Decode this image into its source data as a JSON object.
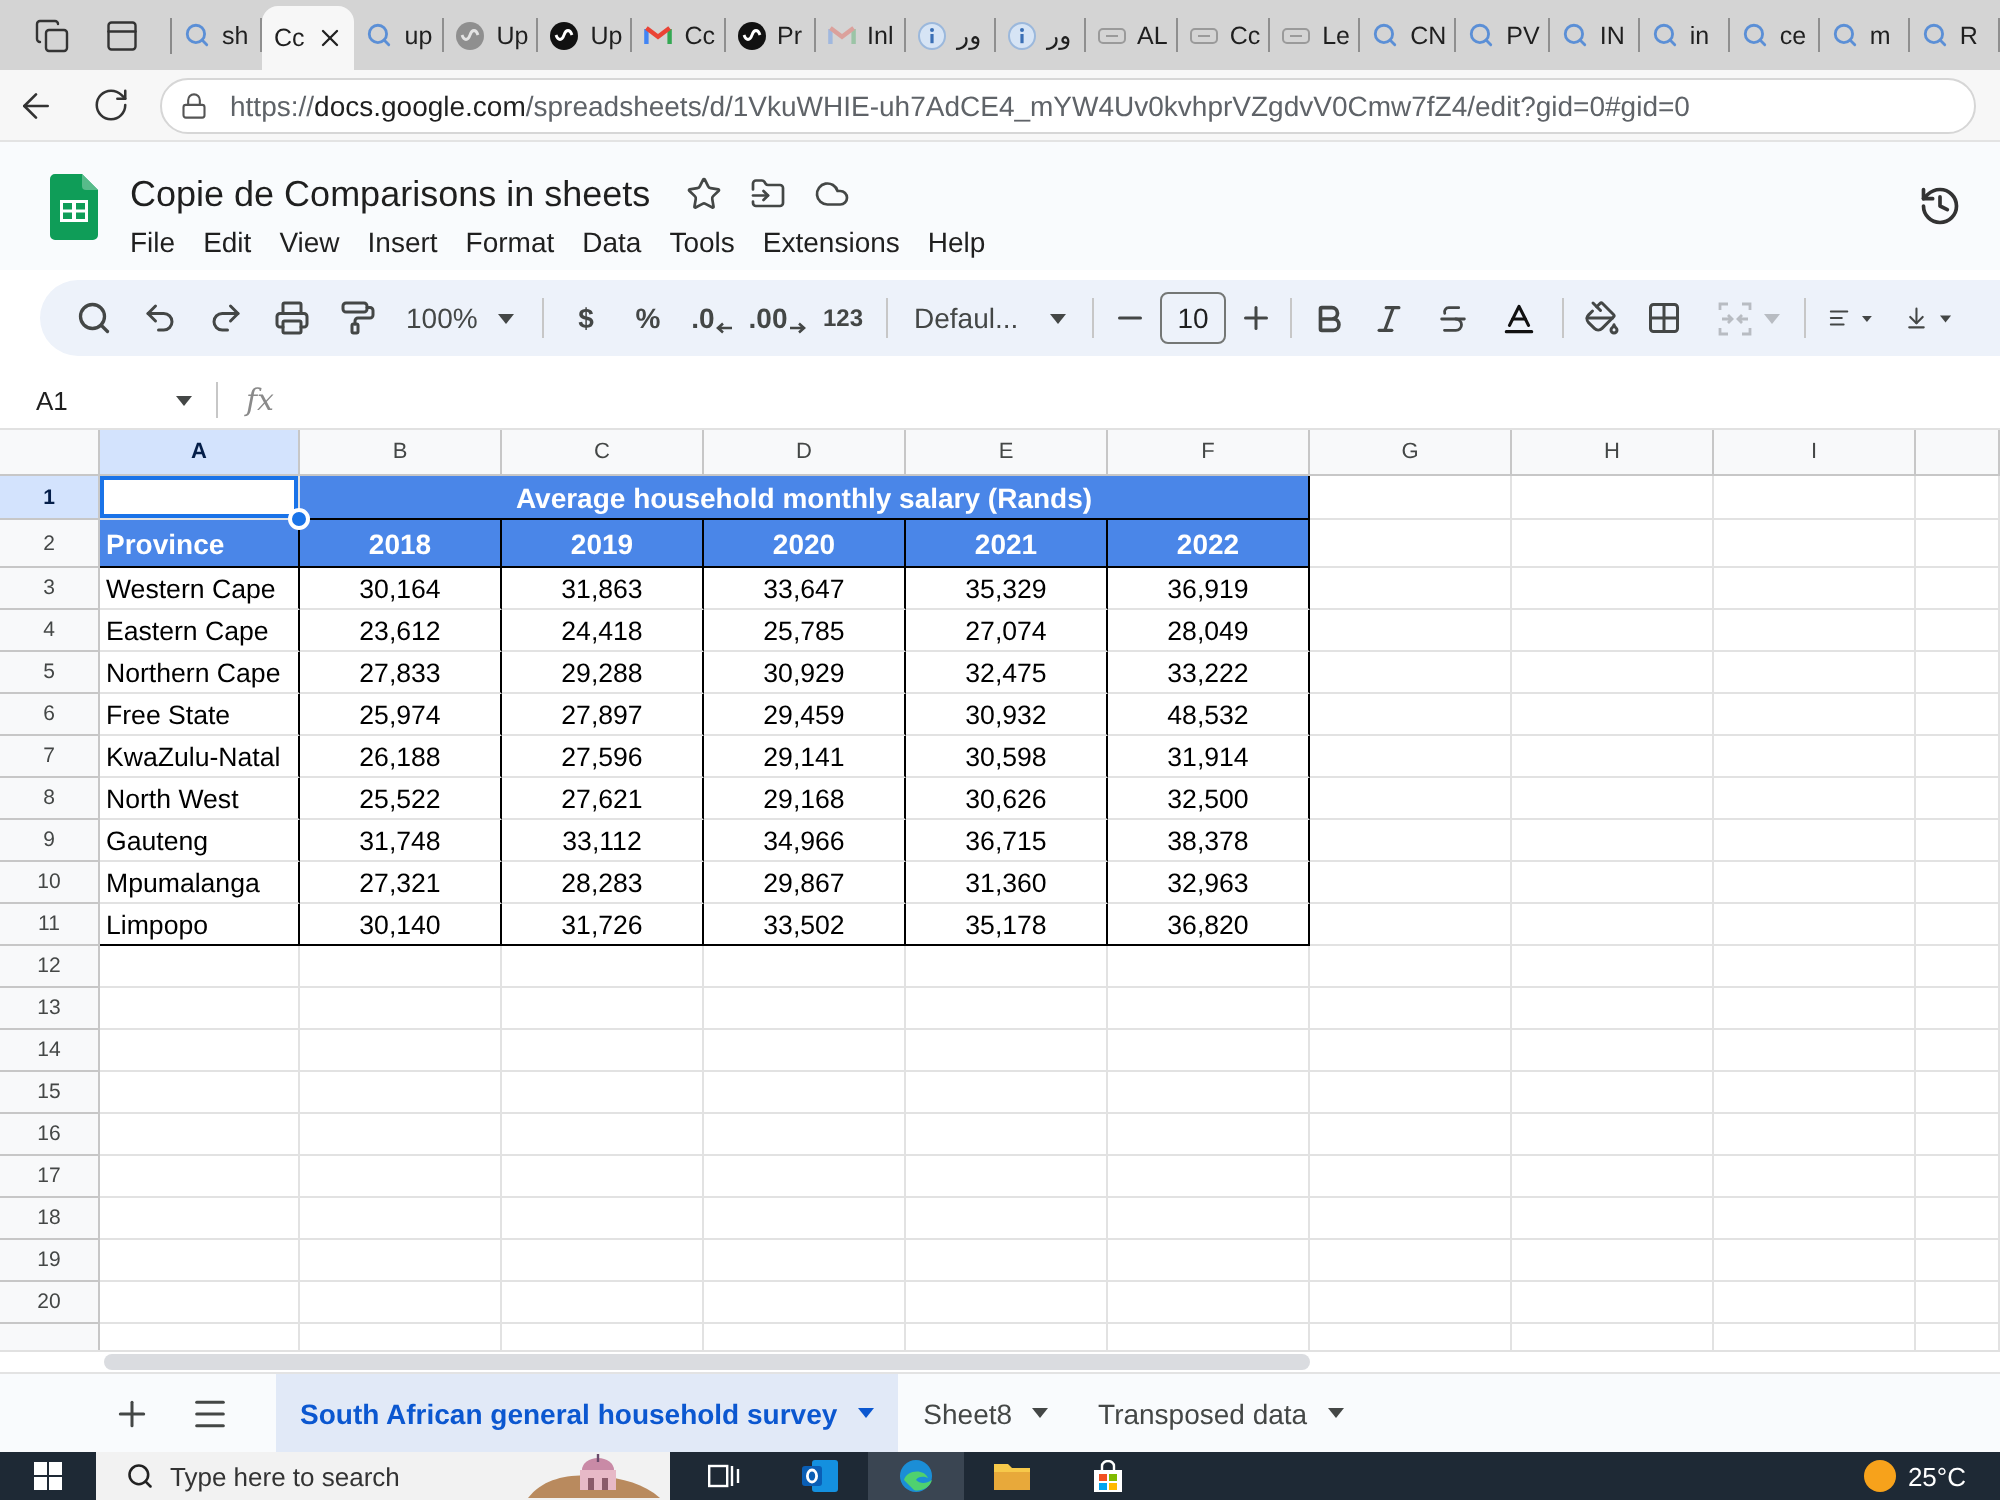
{
  "browser": {
    "tabs": [
      {
        "kind": "search",
        "title": "sh",
        "selected": false,
        "sleeping": false
      },
      {
        "title": "Cc",
        "selected": true
      },
      {
        "kind": "search",
        "title": "up",
        "selected": false,
        "sleeping": false
      },
      {
        "kind": "round-logo",
        "title": "Up",
        "selected": false,
        "sleeping": true
      },
      {
        "kind": "round-logo",
        "title": "Up",
        "selected": false,
        "sleeping": false
      },
      {
        "kind": "mail",
        "title": "Cc",
        "selected": false,
        "sleeping": false
      },
      {
        "kind": "round-logo",
        "title": "Pr",
        "selected": false,
        "sleeping": false
      },
      {
        "kind": "mail",
        "title": "Inl",
        "selected": false,
        "sleeping": true
      },
      {
        "kind": "info",
        "title": "ور",
        "selected": false,
        "sleeping": false
      },
      {
        "kind": "info",
        "title": "ور",
        "selected": false,
        "sleeping": false
      },
      {
        "kind": "tag",
        "title": "AL",
        "selected": false,
        "sleeping": false
      },
      {
        "kind": "tag",
        "title": "Cc",
        "selected": false,
        "sleeping": false
      },
      {
        "kind": "tag",
        "title": "Le",
        "selected": false,
        "sleeping": false
      },
      {
        "kind": "search",
        "title": "CN",
        "selected": false,
        "sleeping": false
      },
      {
        "kind": "search",
        "title": "PV",
        "selected": false,
        "sleeping": false
      },
      {
        "kind": "search",
        "title": "IN",
        "selected": false,
        "sleeping": false
      },
      {
        "kind": "search",
        "title": "in",
        "selected": false,
        "sleeping": false
      },
      {
        "kind": "search",
        "title": "ce",
        "selected": false,
        "sleeping": false
      },
      {
        "kind": "search",
        "title": "m",
        "selected": false,
        "sleeping": false
      },
      {
        "kind": "search",
        "title": "R",
        "selected": false,
        "sleeping": false
      }
    ],
    "address": {
      "scheme": "https://",
      "host": "docs.google.com",
      "path": "/spreadsheets/d/1VkuWHIE-uh7AdCE4_mYW4Uv0kvhprVZgdvV0Cmw7fZ4/edit?gid=0#gid=0"
    }
  },
  "document": {
    "title": "Copie de Comparisons in sheets",
    "menu": [
      "File",
      "Edit",
      "View",
      "Insert",
      "Format",
      "Data",
      "Tools",
      "Extensions",
      "Help"
    ]
  },
  "toolbar": {
    "zoom": "100%",
    "currency": "$",
    "percent": "%",
    "decrease_decimal": ".0",
    "increase_decimal": ".00",
    "number_format": "123",
    "font": "Defaul...",
    "font_size": "10",
    "merge_disabled": true
  },
  "formula_bar": {
    "cell_ref": "A1",
    "function_label": "fx"
  },
  "grid": {
    "columns": [
      {
        "label": "A",
        "selected": true
      },
      {
        "label": "B",
        "selected": false
      },
      {
        "label": "C",
        "selected": false
      },
      {
        "label": "D",
        "selected": false
      },
      {
        "label": "E",
        "selected": false
      },
      {
        "label": "F",
        "selected": false
      },
      {
        "label": "G",
        "selected": false
      },
      {
        "label": "H",
        "selected": false
      },
      {
        "label": "I",
        "selected": false
      }
    ],
    "row_numbers": [
      {
        "label": "1",
        "selected": true
      },
      {
        "label": "2",
        "selected": false
      },
      {
        "label": "3",
        "selected": false
      },
      {
        "label": "4",
        "selected": false
      },
      {
        "label": "5",
        "selected": false
      },
      {
        "label": "6",
        "selected": false
      },
      {
        "label": "7",
        "selected": false
      },
      {
        "label": "8",
        "selected": false
      },
      {
        "label": "9",
        "selected": false
      },
      {
        "label": "10",
        "selected": false
      },
      {
        "label": "11",
        "selected": false
      },
      {
        "label": "12",
        "selected": false
      },
      {
        "label": "13",
        "selected": false
      },
      {
        "label": "14",
        "selected": false
      },
      {
        "label": "15",
        "selected": false
      },
      {
        "label": "16",
        "selected": false
      },
      {
        "label": "17",
        "selected": false
      },
      {
        "label": "18",
        "selected": false
      },
      {
        "label": "19",
        "selected": false
      },
      {
        "label": "20",
        "selected": false
      }
    ],
    "table": {
      "title": "Average household monthly salary (Rands)",
      "header": [
        "Province",
        "2018",
        "2019",
        "2020",
        "2021",
        "2022"
      ],
      "rows": [
        [
          "Western Cape",
          "30,164",
          "31,863",
          "33,647",
          "35,329",
          "36,919"
        ],
        [
          "Eastern Cape",
          "23,612",
          "24,418",
          "25,785",
          "27,074",
          "28,049"
        ],
        [
          "Northern Cape",
          "27,833",
          "29,288",
          "30,929",
          "32,475",
          "33,222"
        ],
        [
          "Free State",
          "25,974",
          "27,897",
          "29,459",
          "30,932",
          "48,532"
        ],
        [
          "KwaZulu-Natal",
          "26,188",
          "27,596",
          "29,141",
          "30,598",
          "31,914"
        ],
        [
          "North West",
          "25,522",
          "27,621",
          "29,168",
          "30,626",
          "32,500"
        ],
        [
          "Gauteng",
          "31,748",
          "33,112",
          "34,966",
          "36,715",
          "38,378"
        ],
        [
          "Mpumalanga",
          "27,321",
          "28,283",
          "29,867",
          "31,360",
          "32,963"
        ],
        [
          "Limpopo",
          "30,140",
          "31,726",
          "33,502",
          "35,178",
          "36,820"
        ]
      ]
    }
  },
  "sheet_tabs": [
    {
      "label": "South African general household survey",
      "selected": true
    },
    {
      "label": "Sheet8",
      "selected": false
    },
    {
      "label": "Transposed data",
      "selected": false
    }
  ],
  "taskbar": {
    "search_placeholder": "Type here to search",
    "apps": [
      {
        "kind": "task-view",
        "selected": false
      },
      {
        "kind": "mail",
        "selected": false
      },
      {
        "kind": "browser",
        "selected": true
      },
      {
        "kind": "folder",
        "selected": false
      },
      {
        "kind": "store",
        "selected": false
      }
    ],
    "weather": "25°C"
  }
}
